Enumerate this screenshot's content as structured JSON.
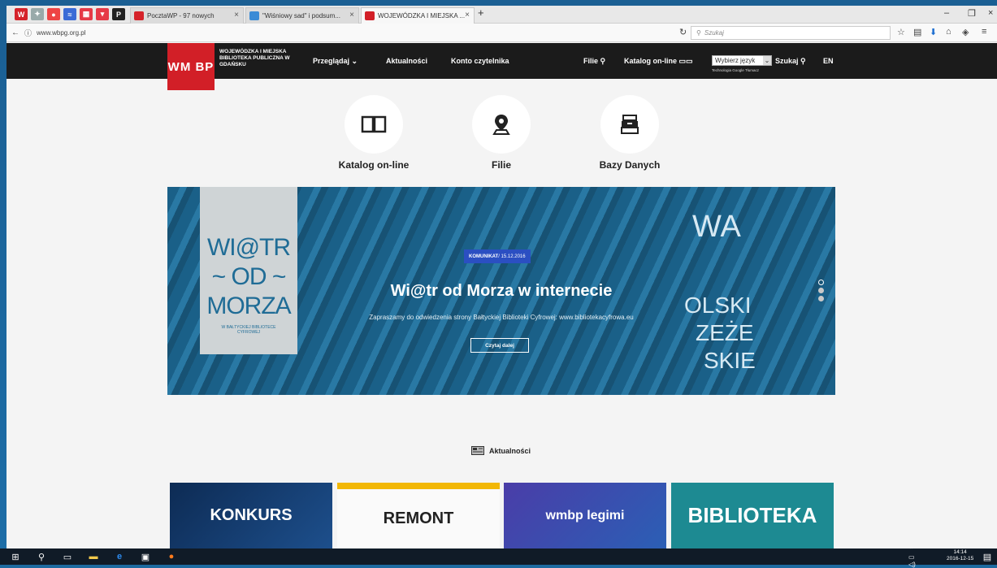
{
  "browser": {
    "tabs": [
      {
        "label": "PocztaWP - 97 nowych"
      },
      {
        "label": "\"Wiśniowy sad\" i podsum..."
      },
      {
        "label": "WOJEWÓDZKA I MIEJSKA ..."
      }
    ],
    "new_tab": "+",
    "url": "www.wbpg.org.pl",
    "search_placeholder": "Szukaj"
  },
  "site": {
    "logo": "WM BP",
    "name": "WOJEWÓDZKA I MIEJSKA BIBLIOTEKA PUBLICZNA W GDAŃSKU",
    "nav": {
      "browse": "Przeglądaj",
      "news": "Aktualności",
      "account": "Konto czytelnika"
    },
    "right": {
      "branches": "Filie",
      "catalog": "Katalog on-line",
      "language_select": "Wybierz język",
      "google_translate": "Technologia Google Tłumacz",
      "search": "Szukaj",
      "lang": "EN"
    }
  },
  "quick_links": [
    {
      "label": "Katalog on-line",
      "icon": "book-icon"
    },
    {
      "label": "Filie",
      "icon": "map-pin-icon"
    },
    {
      "label": "Bazy Danych",
      "icon": "database-icon"
    }
  ],
  "slider": {
    "badge_category": "KOMUNIKAT",
    "badge_date": " / 15.12.2016",
    "title": "Wi@tr od Morza w internecie",
    "text": "Zapraszamy do odwiedzenia strony Bałtyckiej Biblioteki Cyfrowej: www.bibliotekacyfrowa.eu",
    "button": "Czytaj dalej",
    "poster_lines": [
      "WI@TR",
      "~ OD ~",
      "MORZA"
    ],
    "poster_small": "W BAŁTYCKIEJ BIBLIOTECE CYFROWEJ",
    "bg_words": [
      "WA",
      "OLSKI",
      "ZEŻE",
      "SKIE"
    ]
  },
  "news": {
    "heading": "Aktualności",
    "cards": [
      {
        "text": "KONKURS"
      },
      {
        "text": "REMONT"
      },
      {
        "text": "wmbp legimi"
      },
      {
        "text": "BIBLIOTEKA"
      }
    ]
  },
  "taskbar": {
    "time": "14:14",
    "date": "2016-12-15"
  }
}
